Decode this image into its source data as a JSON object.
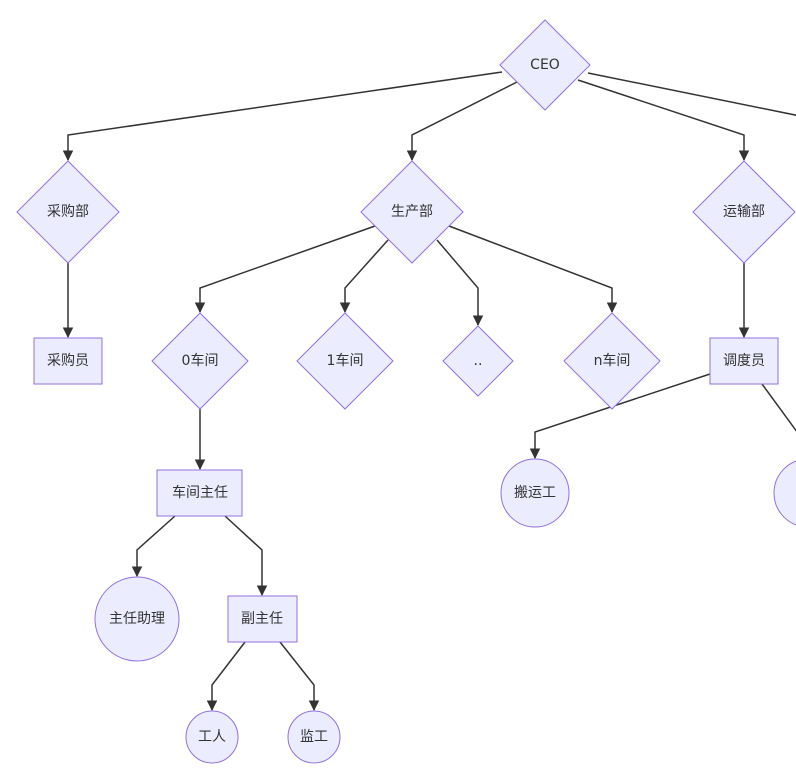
{
  "colors": {
    "node_fill": "#ECECFF",
    "node_stroke": "#9370DB",
    "edge": "#333333"
  },
  "nodes": {
    "ceo": "CEO",
    "purchasing_dept": "采购部",
    "production_dept": "生产部",
    "transport_dept": "运输部",
    "purchaser": "采购员",
    "workshop_0": "0车间",
    "workshop_1": "1车间",
    "workshop_etc": "..",
    "workshop_n": "n车间",
    "dispatcher": "调度员",
    "workshop_director": "车间主任",
    "porter": "搬运工",
    "director_assistant": "主任助理",
    "deputy_director": "副主任",
    "worker": "工人",
    "supervisor": "监工"
  }
}
